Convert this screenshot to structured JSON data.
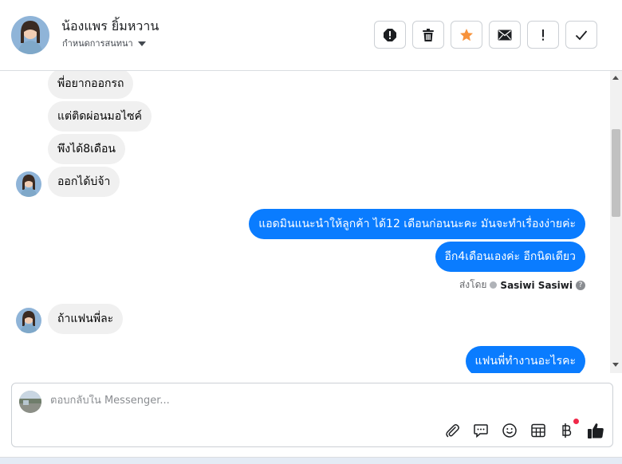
{
  "header": {
    "contact_name": "น้องแพร ยิ้มหวาน",
    "assign_label": "กำหนดการสนทนา",
    "actions": [
      {
        "icon": "alert-circle-icon",
        "label": "spam"
      },
      {
        "icon": "trash-icon",
        "label": "delete"
      },
      {
        "icon": "star-icon",
        "label": "star"
      },
      {
        "icon": "envelope-icon",
        "label": "mark unread"
      },
      {
        "icon": "exclamation-icon",
        "label": "follow up"
      },
      {
        "icon": "check-icon",
        "label": "done"
      }
    ]
  },
  "messages": [
    {
      "side": "in",
      "text": "พี่อยากออกรถ"
    },
    {
      "side": "in",
      "text": "แต่ติดผ่อนมอไซค์"
    },
    {
      "side": "in",
      "text": "พึงได้8เดือน"
    },
    {
      "side": "in",
      "text": "ออกได้บ่จ้า"
    },
    {
      "side": "out",
      "text": "แอดมินแนะนำให้ลูกค้า ได้12 เดือนก่อนนะคะ มันจะทำเรื่องง่ายค่ะ"
    },
    {
      "side": "out",
      "text": "อีก4เดือนเองค่ะ อีกนิดเดียว"
    },
    {
      "side": "in",
      "text": "ถ้าแฟนพี่ละ"
    },
    {
      "side": "out",
      "text": "แฟนพี่ทำงานอะไรคะ"
    }
  ],
  "sent_by": {
    "prefix": "ส่งโดย",
    "name": "Sasiwi Sasiwi"
  },
  "composer": {
    "placeholder": "ตอบกลับใน Messenger...",
    "tools": [
      "paperclip-icon",
      "chat-bubble-icon",
      "smiley-icon",
      "calendar-grid-icon",
      "baht-icon",
      "thumbs-up-icon"
    ]
  },
  "colors": {
    "outgoing_bubble": "#0a7cff",
    "incoming_bubble": "#f0f0f0",
    "star": "#f7923b",
    "thumbs_up": "#1c1e21",
    "notification_dot": "#f02849"
  }
}
